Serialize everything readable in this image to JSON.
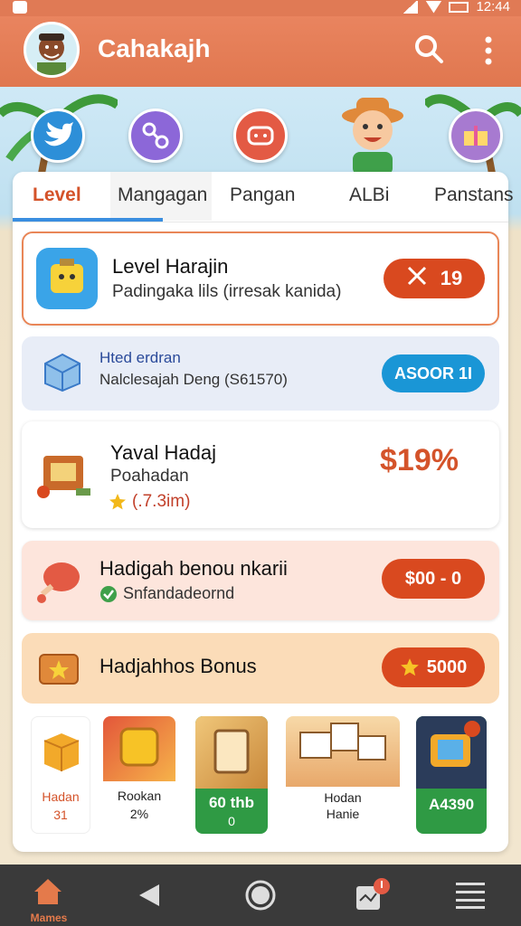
{
  "status_bar": {
    "time": "12:44"
  },
  "app_bar": {
    "title": "Cahakajh"
  },
  "tabs": [
    "Level",
    "Mangagan",
    "Pangan",
    "ALBi",
    "Panstans"
  ],
  "rows": [
    {
      "title": "Level Harajin",
      "subtitle": "Padingaka lils (irresak kanida)",
      "badge": "19"
    },
    {
      "title": "Hted erdran",
      "subtitle": "Nalclesajah Deng (S61570)",
      "badge": "ASOOR 1I"
    },
    {
      "title": "Yaval Hadaj",
      "subtitle": "Poahadan",
      "rating": "(.7.3im)",
      "price": "$19%"
    },
    {
      "title": "Hadigah benou nkarii",
      "subtitle": "Snfandadeornd",
      "badge": "$00 - 0"
    },
    {
      "title": "Hadjahhos Bonus",
      "badge": "5000"
    }
  ],
  "tiles": [
    {
      "line1": "Hadan",
      "line2": "31"
    },
    {
      "line1": "Rookan",
      "line2": "2%"
    },
    {
      "line1": "60 thb",
      "line2": "0"
    },
    {
      "line1": "Hodan",
      "line2": "Hanie"
    },
    {
      "line1": "A4390",
      "line2": ""
    }
  ],
  "nav": {
    "home_label": "Mames"
  },
  "colors": {
    "accent": "#e0774f",
    "danger": "#d9491f",
    "blue": "#1a96d6"
  }
}
